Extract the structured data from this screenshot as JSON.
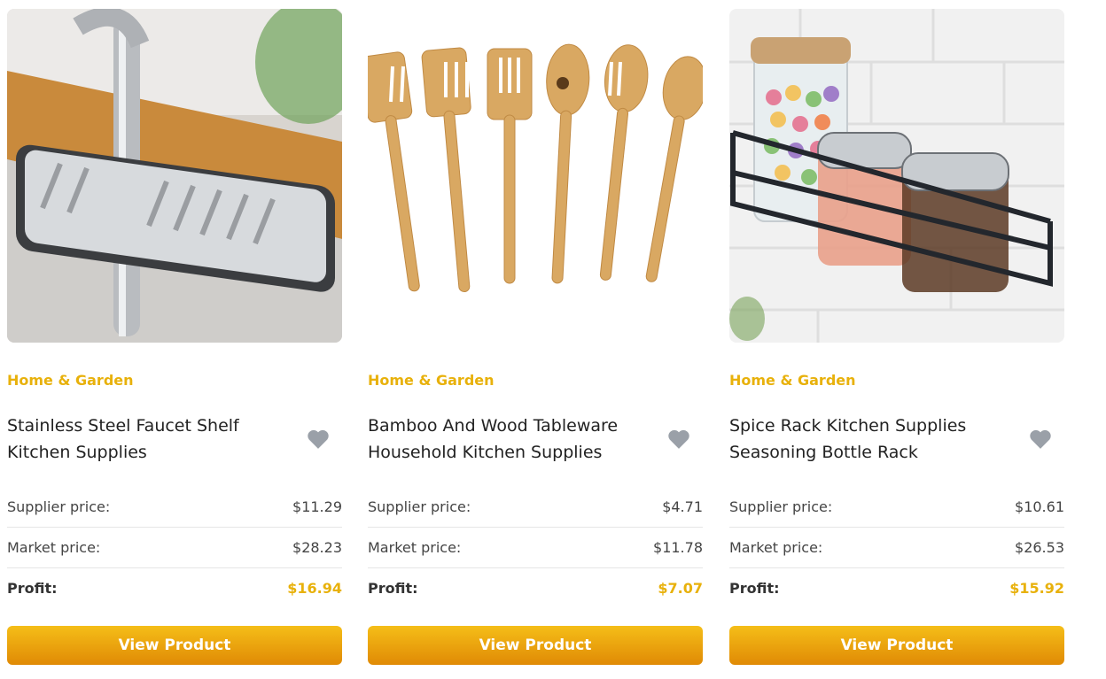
{
  "products": [
    {
      "image": "faucet-shelf-photo",
      "category": "Home & Garden",
      "title": "Stainless Steel Faucet Shelf Kitchen Supplies",
      "supplier_label": "Supplier price:",
      "supplier_price": "$11.29",
      "market_label": "Market price:",
      "market_price": "$28.23",
      "profit_label": "Profit:",
      "profit": "$16.94",
      "button": "View Product"
    },
    {
      "image": "bamboo-utensils-photo",
      "category": "Home & Garden",
      "title": "Bamboo And Wood Tableware Household Kitchen Supplies",
      "supplier_label": "Supplier price:",
      "supplier_price": "$4.71",
      "market_label": "Market price:",
      "market_price": "$11.78",
      "profit_label": "Profit:",
      "profit": "$7.07",
      "button": "View Product"
    },
    {
      "image": "spice-rack-photo",
      "category": "Home & Garden",
      "title": "Spice Rack Kitchen Supplies Seasoning Bottle Rack",
      "supplier_label": "Supplier price:",
      "supplier_price": "$10.61",
      "market_label": "Market price:",
      "market_price": "$26.53",
      "profit_label": "Profit:",
      "profit": "$15.92",
      "button": "View Product"
    }
  ],
  "colors": {
    "accent": "#e8b10b",
    "button_top": "#f5be18",
    "button_bottom": "#e08a05",
    "heart": "#9aa0a8"
  },
  "icons": {
    "favorite": "heart-icon"
  }
}
